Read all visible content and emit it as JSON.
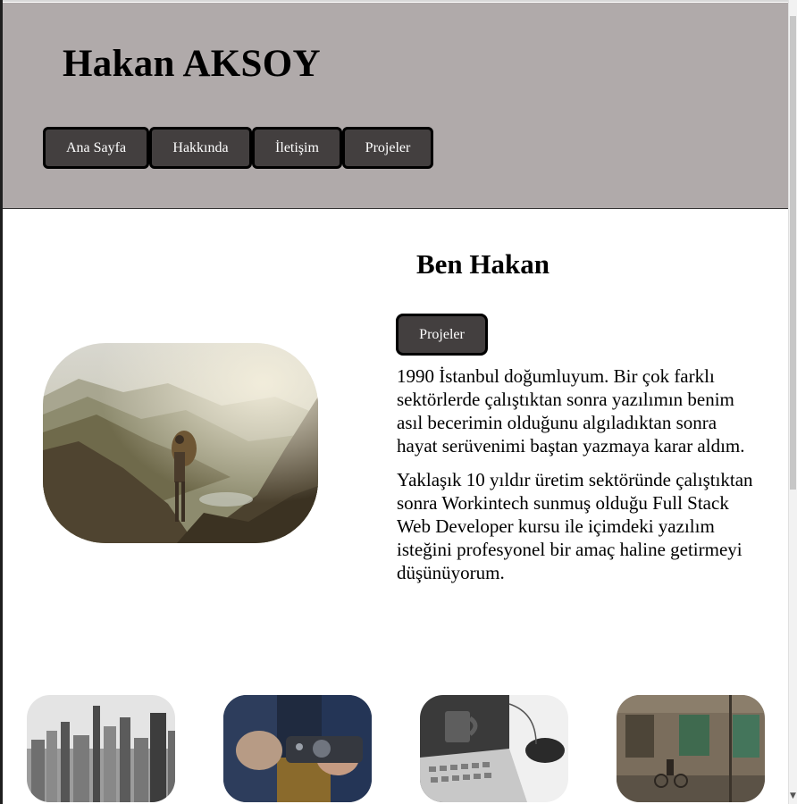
{
  "header": {
    "title": "Hakan AKSOY",
    "nav": [
      "Ana Sayfa",
      "Hakkında",
      "İletişim",
      "Projeler"
    ]
  },
  "intro": {
    "heading": "Ben Hakan",
    "button": "Projeler",
    "paragraphs": [
      "1990 İstanbul doğumluyum. Bir çok farklı sektörlerde çalıştıktan sonra yazılımın benim asıl becerimin olduğunu algıladıktan sonra hayat serüvenimi baştan yazmaya karar aldım.",
      "Yaklaşık 10 yıldır üretim sektöründe çalıştıktan sonra Workintech sunmuş olduğu Full Stack Web Developer kursu ile içimdeki yazılım isteğini profesyonel bir amaç haline getirmeyi düşünüyorum."
    ]
  },
  "colors": {
    "header_bg": "#b0aaaa",
    "button_bg": "#433f3f",
    "button_border": "#000000"
  },
  "icons": {
    "scroll_down": "scroll-down-arrow-icon"
  }
}
